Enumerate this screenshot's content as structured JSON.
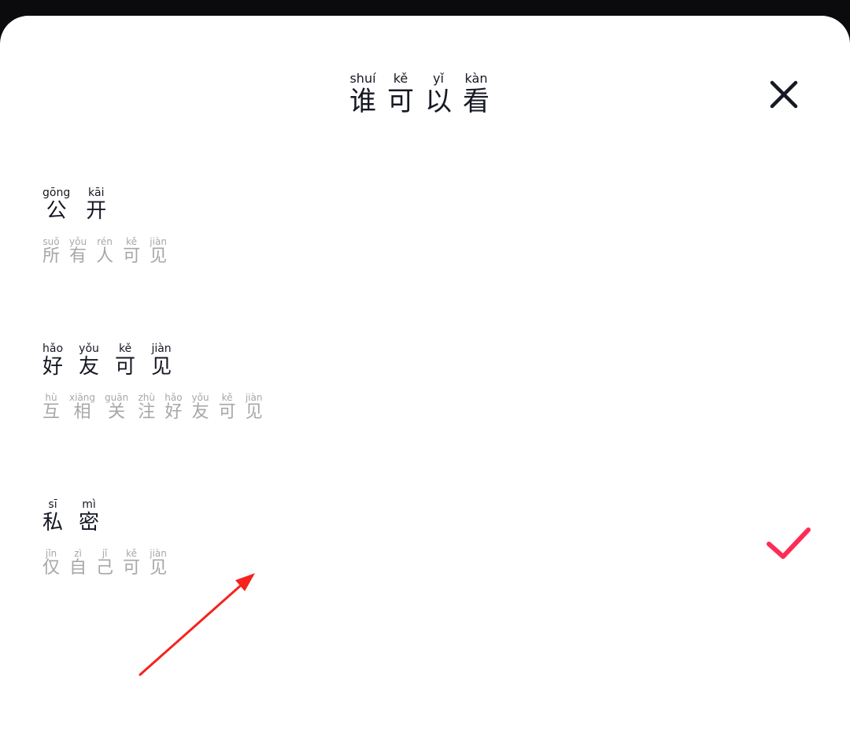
{
  "sheet": {
    "title": [
      {
        "py": "shuí",
        "hz": "谁"
      },
      {
        "py": "kě",
        "hz": "可"
      },
      {
        "py": "yǐ",
        "hz": "以"
      },
      {
        "py": "kàn",
        "hz": "看"
      }
    ],
    "close_icon": "close-icon"
  },
  "options": [
    {
      "title": [
        {
          "py": "gōng",
          "hz": "公"
        },
        {
          "py": "kāi",
          "hz": "开"
        }
      ],
      "desc": [
        {
          "py": "suǒ",
          "hz": "所"
        },
        {
          "py": "yǒu",
          "hz": "有"
        },
        {
          "py": "rén",
          "hz": "人"
        },
        {
          "py": "kě",
          "hz": "可"
        },
        {
          "py": "jiàn",
          "hz": "见"
        }
      ],
      "selected": false
    },
    {
      "title": [
        {
          "py": "hǎo",
          "hz": "好"
        },
        {
          "py": "yǒu",
          "hz": "友"
        },
        {
          "py": "kě",
          "hz": "可"
        },
        {
          "py": "jiàn",
          "hz": "见"
        }
      ],
      "desc": [
        {
          "py": "hù",
          "hz": "互"
        },
        {
          "py": "xiāng",
          "hz": "相"
        },
        {
          "py": "guān",
          "hz": "关"
        },
        {
          "py": "zhù",
          "hz": "注"
        },
        {
          "py": "hǎo",
          "hz": "好"
        },
        {
          "py": "yǒu",
          "hz": "友"
        },
        {
          "py": "kě",
          "hz": "可"
        },
        {
          "py": "jiàn",
          "hz": "见"
        }
      ],
      "selected": false
    },
    {
      "title": [
        {
          "py": "sī",
          "hz": "私"
        },
        {
          "py": "mì",
          "hz": "密"
        }
      ],
      "desc": [
        {
          "py": "jǐn",
          "hz": "仅"
        },
        {
          "py": "zì",
          "hz": "自"
        },
        {
          "py": "jǐ",
          "hz": "己"
        },
        {
          "py": "kě",
          "hz": "可"
        },
        {
          "py": "jiàn",
          "hz": "见"
        }
      ],
      "selected": true
    }
  ],
  "colors": {
    "check": "#fe2c55",
    "arrow": "#f5231e",
    "title_text": "#161823",
    "desc_text": "#a7a7ab"
  }
}
